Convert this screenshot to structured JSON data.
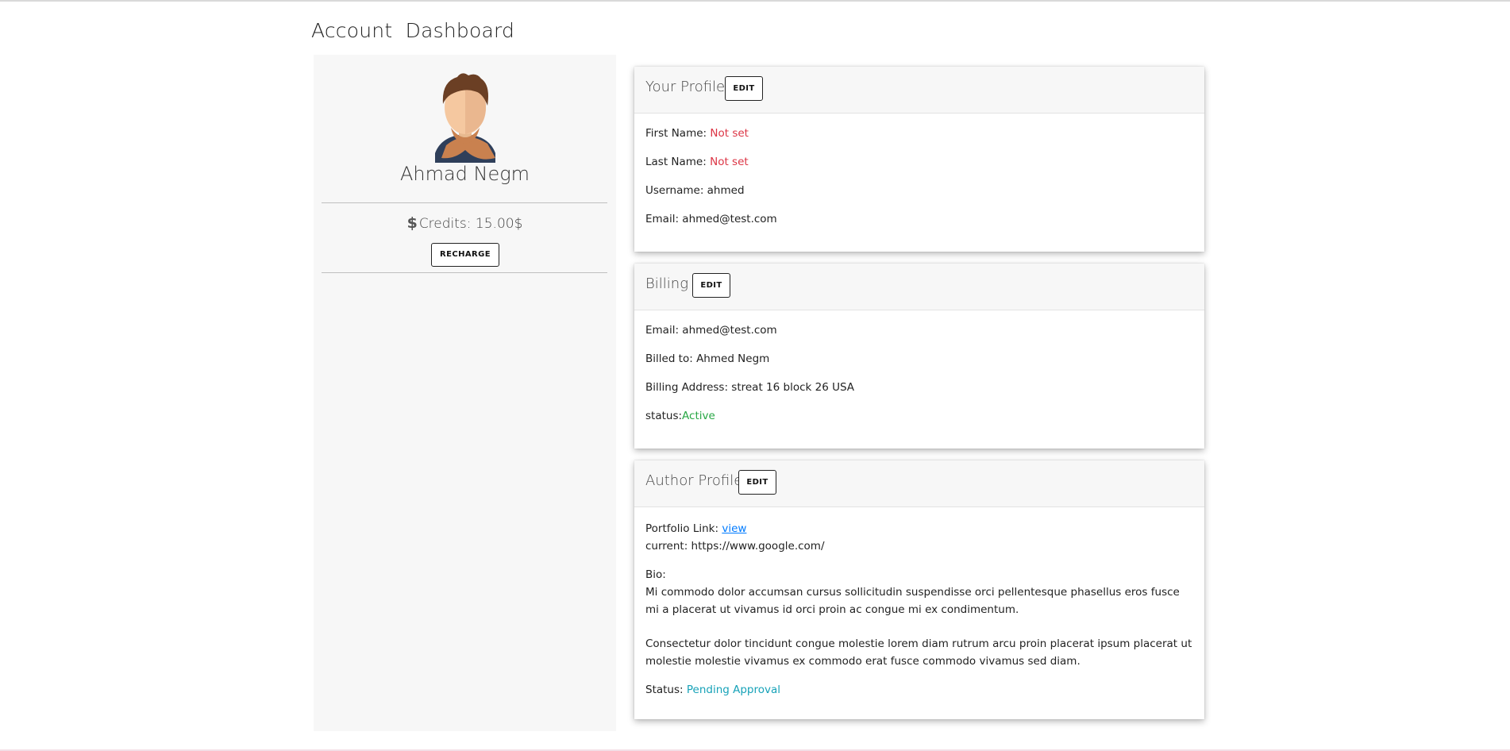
{
  "page": {
    "title": "Account  Dashboard"
  },
  "sidebar": {
    "user_name": "Ahmad Negm",
    "credits_label": "Credits: 15.00$",
    "recharge_label": "RECHARGE"
  },
  "profile_card": {
    "title": "Your Profile",
    "edit_label": "EDIT",
    "first_name_label": "First Name: ",
    "first_name_value": "Not set",
    "last_name_label": "Last Name: ",
    "last_name_value": "Not set",
    "username": "Username: ahmed",
    "email": "Email: ahmed@test.com"
  },
  "billing_card": {
    "title": "Billing",
    "edit_label": "EDIT",
    "email": "Email: ahmed@test.com",
    "billed_to": "Billed to: Ahmed Negm",
    "address": "Billing Address: streat 16 block 26 USA",
    "status_label": "status:",
    "status_value": "Active"
  },
  "author_card": {
    "title": "Author Profile",
    "edit_label": "EDIT",
    "portfolio_label": "Portfolio Link: ",
    "portfolio_link_text": "view",
    "current": "current: https://www.google.com/",
    "bio_label": "Bio:",
    "bio_paragraph_1": "Mi commodo dolor accumsan cursus sollicitudin suspendisse orci pellentesque phasellus eros fusce mi a placerat ut vivamus id orci proin ac congue mi ex condimentum.",
    "bio_paragraph_2": "Consectetur dolor tincidunt congue molestie lorem diam rutrum arcu proin placerat ipsum placerat ut molestie molestie vivamus ex commodo erat fusce commodo vivamus sed diam.",
    "status_label": "Status: ",
    "status_value": "Pending Approval"
  },
  "icons": {
    "avatar": "user-avatar",
    "credits": "dollar-icon"
  },
  "colors": {
    "not_set": "#dc3545",
    "active": "#28a745",
    "pending": "#17a2b8",
    "link": "#007bff",
    "sidebar_bg": "#f7f7f7"
  }
}
